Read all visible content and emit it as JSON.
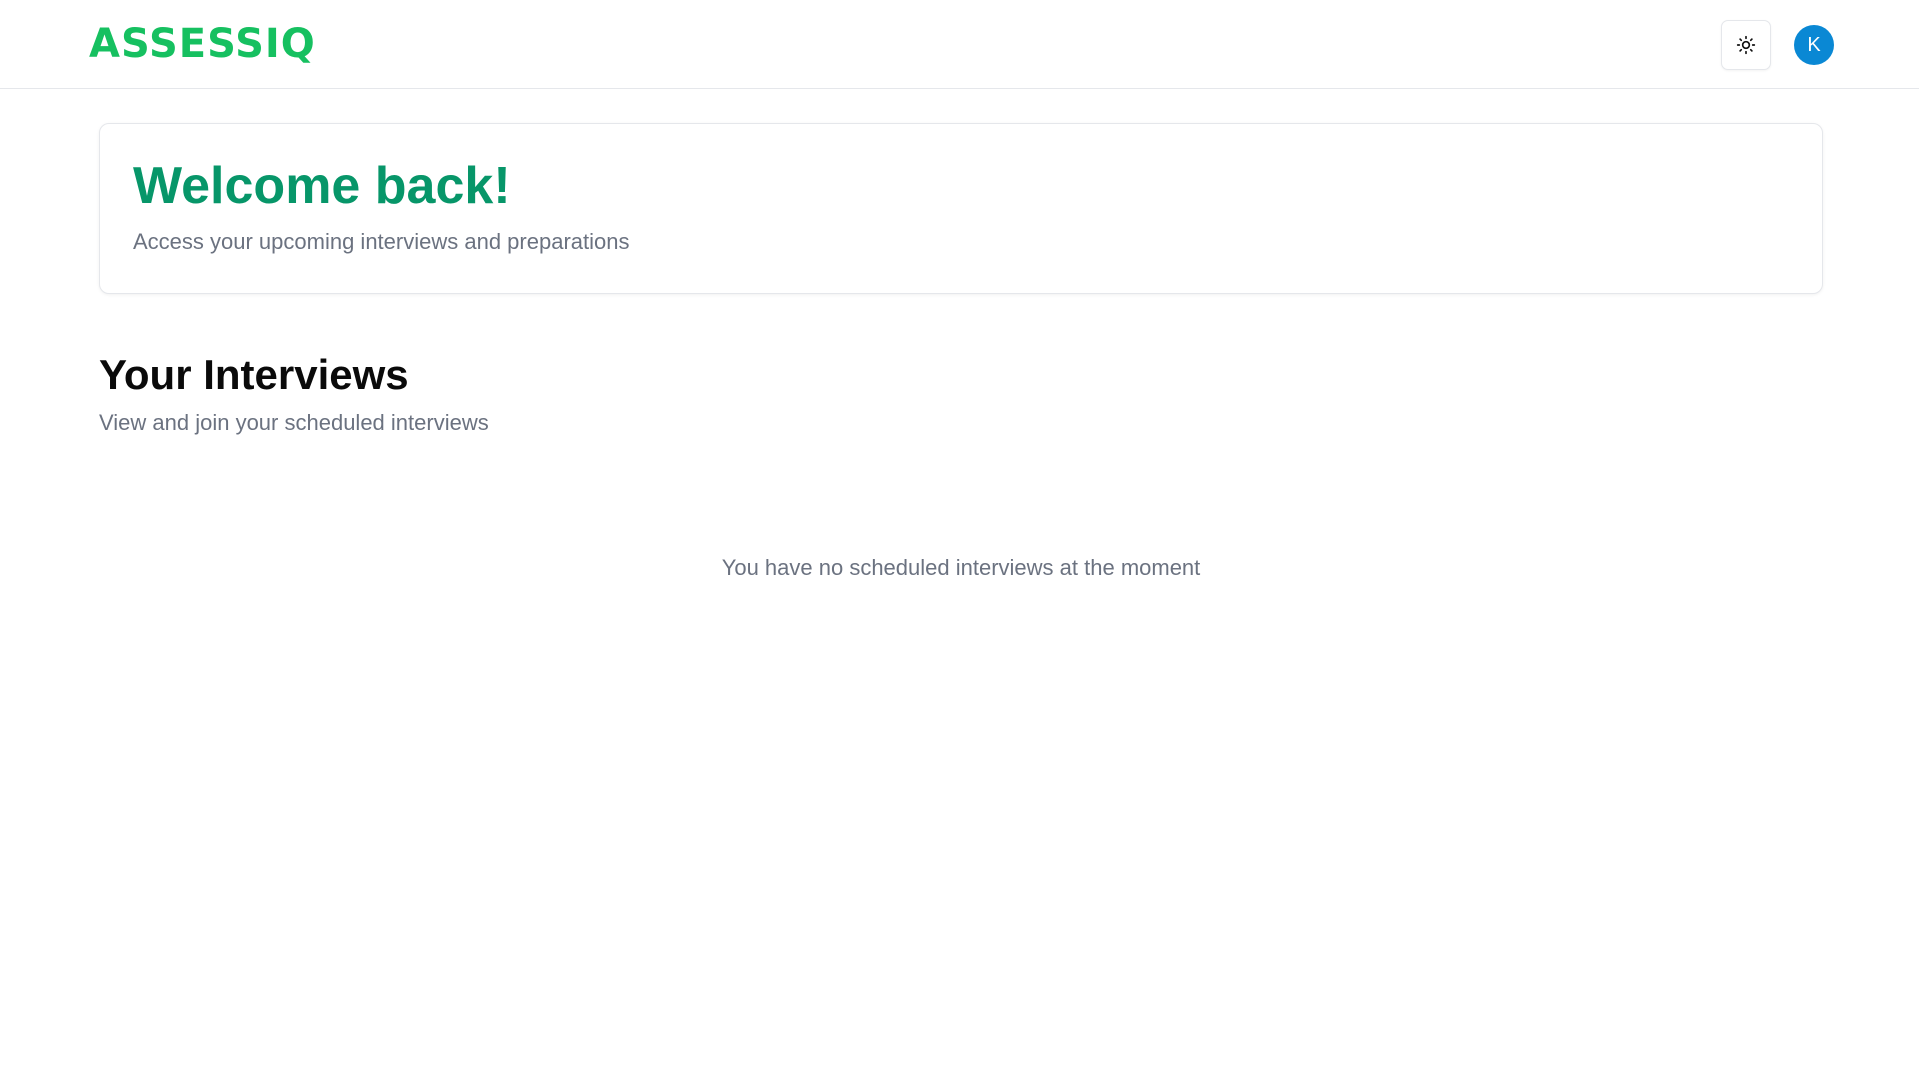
{
  "header": {
    "logo_text": "ASSESSIQ",
    "theme_toggle_icon": "sun-icon",
    "avatar_initial": "K",
    "brand_color": "#16c060",
    "avatar_color": "#0a88d4"
  },
  "welcome": {
    "title": "Welcome back!",
    "subtitle": "Access your upcoming interviews and preparations",
    "title_color": "#079669"
  },
  "interviews": {
    "title": "Your Interviews",
    "subtitle": "View and join your scheduled interviews",
    "empty_message": "You have no scheduled interviews at the moment"
  }
}
